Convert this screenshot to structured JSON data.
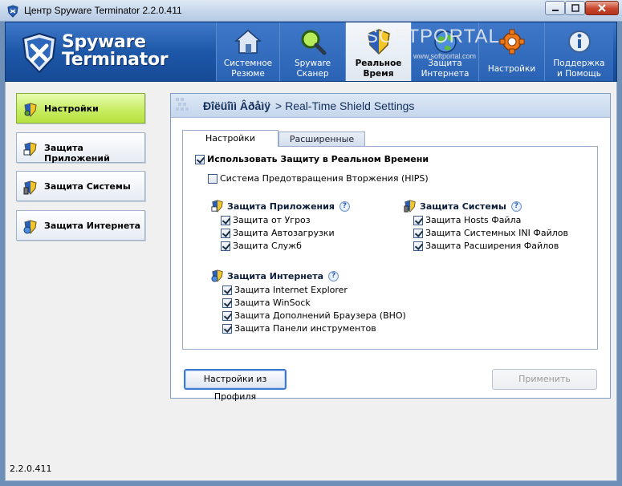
{
  "window": {
    "title": "Центр Spyware Terminator 2.2.0.411"
  },
  "logo": {
    "line1": "Spyware",
    "line2": "Terminator"
  },
  "nav": [
    {
      "line1": "Системное",
      "line2": "Резюме",
      "icon": "home-icon"
    },
    {
      "line1": "Spyware",
      "line2": "Сканер",
      "icon": "magnifier-icon"
    },
    {
      "line1": "Реальное",
      "line2": "Время",
      "icon": "shield-icon",
      "active": true
    },
    {
      "line1": "Защита",
      "line2": "Интернета",
      "icon": "globe-icon"
    },
    {
      "line1": "Настройки",
      "line2": "",
      "icon": "gear-icon"
    },
    {
      "line1": "Поддержка",
      "line2": "и Помощь",
      "icon": "info-icon"
    }
  ],
  "watermark": {
    "big": "SOFTPORTAL",
    "small": "www.softportal.com"
  },
  "sidebar": [
    {
      "label": "Настройки",
      "active": true
    },
    {
      "label": "Защита Приложений"
    },
    {
      "label": "Защита Системы"
    },
    {
      "label": "Защита Интернета"
    }
  ],
  "version": "2.2.0.411",
  "panel": {
    "title_garbled": "Ðîëüîìì Âðåìÿ",
    "title": "> Real-Time Shield Settings",
    "tabs": [
      "Настройки",
      "Расширенные"
    ],
    "main_checkbox": "Использовать Защиту в Реальном Времени",
    "hips_checkbox": "Система Предотвращения Вторжения (HIPS)",
    "groups": {
      "app": {
        "title": "Защита Приложения",
        "items": [
          "Защита от Угроз",
          "Защита Автозагрузки",
          "Защита Служб"
        ]
      },
      "system": {
        "title": "Защита Системы",
        "items": [
          "Защита Hosts Файла",
          "Защита Системных INI Файлов",
          "Защита Расширения Файлов"
        ]
      },
      "internet": {
        "title": "Защита Интернета",
        "items": [
          "Защита Internet Explorer",
          "Защита WinSock",
          "Защита Дополнений Браузера (BHO)",
          "Защита Панели инструментов"
        ]
      }
    },
    "help_glyph": "?",
    "btn_profile": "Настройки из Профиля",
    "btn_apply": "Применить"
  },
  "colors": {
    "header": "#1e58a9",
    "active_sidebar": "#c6ec5e",
    "panel_border": "#7f9dc4"
  }
}
